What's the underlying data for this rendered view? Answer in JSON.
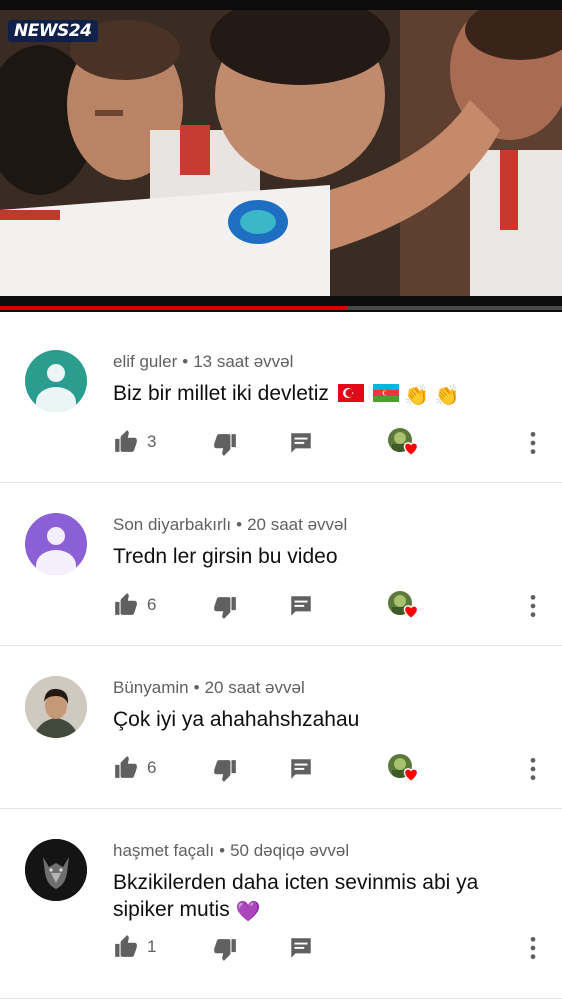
{
  "video": {
    "logo": "NEWS24",
    "progress": 0.62
  },
  "comments": [
    {
      "author": "elif guler",
      "time": "13 saat əvvəl",
      "text": "Biz bir millet iki devletiz",
      "emojis": "👏 👏",
      "likes": "3",
      "avatar": "default-avatar-teal",
      "avatar_color": "#2a9d8f"
    },
    {
      "author": "Son diyarbakırlı",
      "time": "20 saat əvvəl",
      "text": "Tredn ler girsin bu video",
      "likes": "6",
      "avatar": "default-avatar-purple",
      "avatar_color": "#8b5fd6"
    },
    {
      "author": "Bünyamin",
      "time": "20 saat əvvəl",
      "text": "Çok iyi ya ahahahshzahau",
      "likes": "6",
      "avatar": "photo-avatar"
    },
    {
      "author": "haşmet façalı",
      "time": "50 dəqiqə əvvəl",
      "text_line1": "Bkzikilerden daha icten sevinmis abi ya",
      "text_line2": "sipiker mutis",
      "emoji": "💜",
      "likes": "1",
      "avatar": "wolf-avatar"
    }
  ],
  "colors": {
    "accent_red": "#e00000",
    "meta_gray": "#606060",
    "icon_gray": "#606060",
    "heart_red": "#ff0000"
  }
}
